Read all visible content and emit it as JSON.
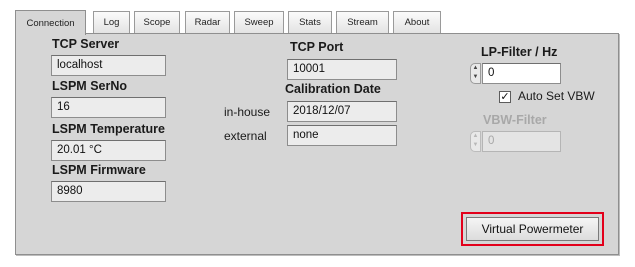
{
  "tabs": [
    {
      "label": "Connection",
      "active": true
    },
    {
      "label": "Log"
    },
    {
      "label": "Scope"
    },
    {
      "label": "Radar"
    },
    {
      "label": "Sweep"
    },
    {
      "label": "Stats"
    },
    {
      "label": "Stream"
    },
    {
      "label": "About"
    }
  ],
  "tcp_server": {
    "label": "TCP Server",
    "value": "localhost"
  },
  "lspm_serno": {
    "label": "LSPM SerNo",
    "value": "16"
  },
  "lspm_temperature": {
    "label": "LSPM Temperature",
    "value": "20.01 °C"
  },
  "lspm_firmware": {
    "label": "LSPM Firmware",
    "value": "8980"
  },
  "tcp_port": {
    "label": "TCP Port",
    "value": "10001"
  },
  "calibration": {
    "label": "Calibration Date",
    "inhouse_label": "in-house",
    "inhouse_value": "2018/12/07",
    "external_label": "external",
    "external_value": "none"
  },
  "lp_filter": {
    "label": "LP-Filter / Hz",
    "value": "0"
  },
  "auto_set_vbw": {
    "label": "Auto Set VBW",
    "checked": true,
    "mark": "✓"
  },
  "vbw_filter": {
    "label": "VBW-Filter",
    "value": "0",
    "enabled": false
  },
  "virtual_powermeter": {
    "label": "Virtual Powermeter"
  },
  "colors": {
    "highlight": "#e3001b",
    "panel": "#d6d6d6"
  },
  "spinner": {
    "up": "▲",
    "down": "▼"
  }
}
